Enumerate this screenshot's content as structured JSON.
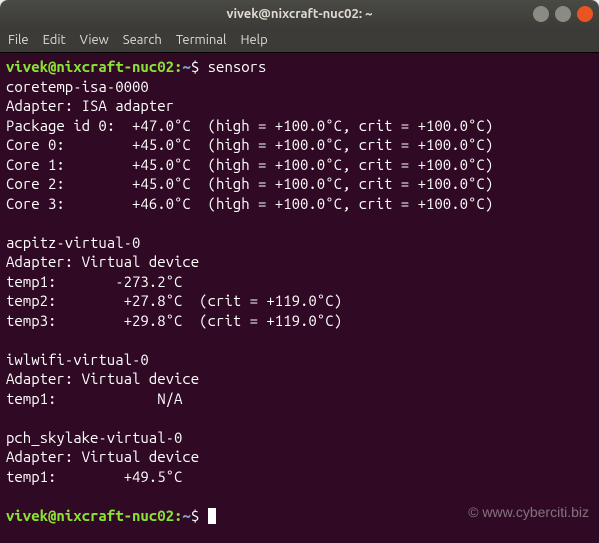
{
  "window": {
    "title": "vivek@nixcraft-nuc02: ~"
  },
  "menubar": {
    "items": [
      "File",
      "Edit",
      "View",
      "Search",
      "Terminal",
      "Help"
    ]
  },
  "prompt": {
    "user_host": "vivek@nixcraft-nuc02",
    "sep": ":",
    "path": "~",
    "symbol": "$"
  },
  "command": "sensors",
  "output": {
    "coretemp": {
      "header": "coretemp-isa-0000",
      "adapter": "Adapter: ISA adapter",
      "rows": [
        "Package id 0:  +47.0°C  (high = +100.0°C, crit = +100.0°C)",
        "Core 0:        +45.0°C  (high = +100.0°C, crit = +100.0°C)",
        "Core 1:        +45.0°C  (high = +100.0°C, crit = +100.0°C)",
        "Core 2:        +45.0°C  (high = +100.0°C, crit = +100.0°C)",
        "Core 3:        +46.0°C  (high = +100.0°C, crit = +100.0°C)"
      ]
    },
    "acpitz": {
      "header": "acpitz-virtual-0",
      "adapter": "Adapter: Virtual device",
      "rows": [
        "temp1:       -273.2°C",
        "temp2:        +27.8°C  (crit = +119.0°C)",
        "temp3:        +29.8°C  (crit = +119.0°C)"
      ]
    },
    "iwlwifi": {
      "header": "iwlwifi-virtual-0",
      "adapter": "Adapter: Virtual device",
      "rows": [
        "temp1:            N/A"
      ]
    },
    "pch": {
      "header": "pch_skylake-virtual-0",
      "adapter": "Adapter: Virtual device",
      "rows": [
        "temp1:        +49.5°C"
      ]
    }
  },
  "watermark": "© www.cyberciti.biz"
}
